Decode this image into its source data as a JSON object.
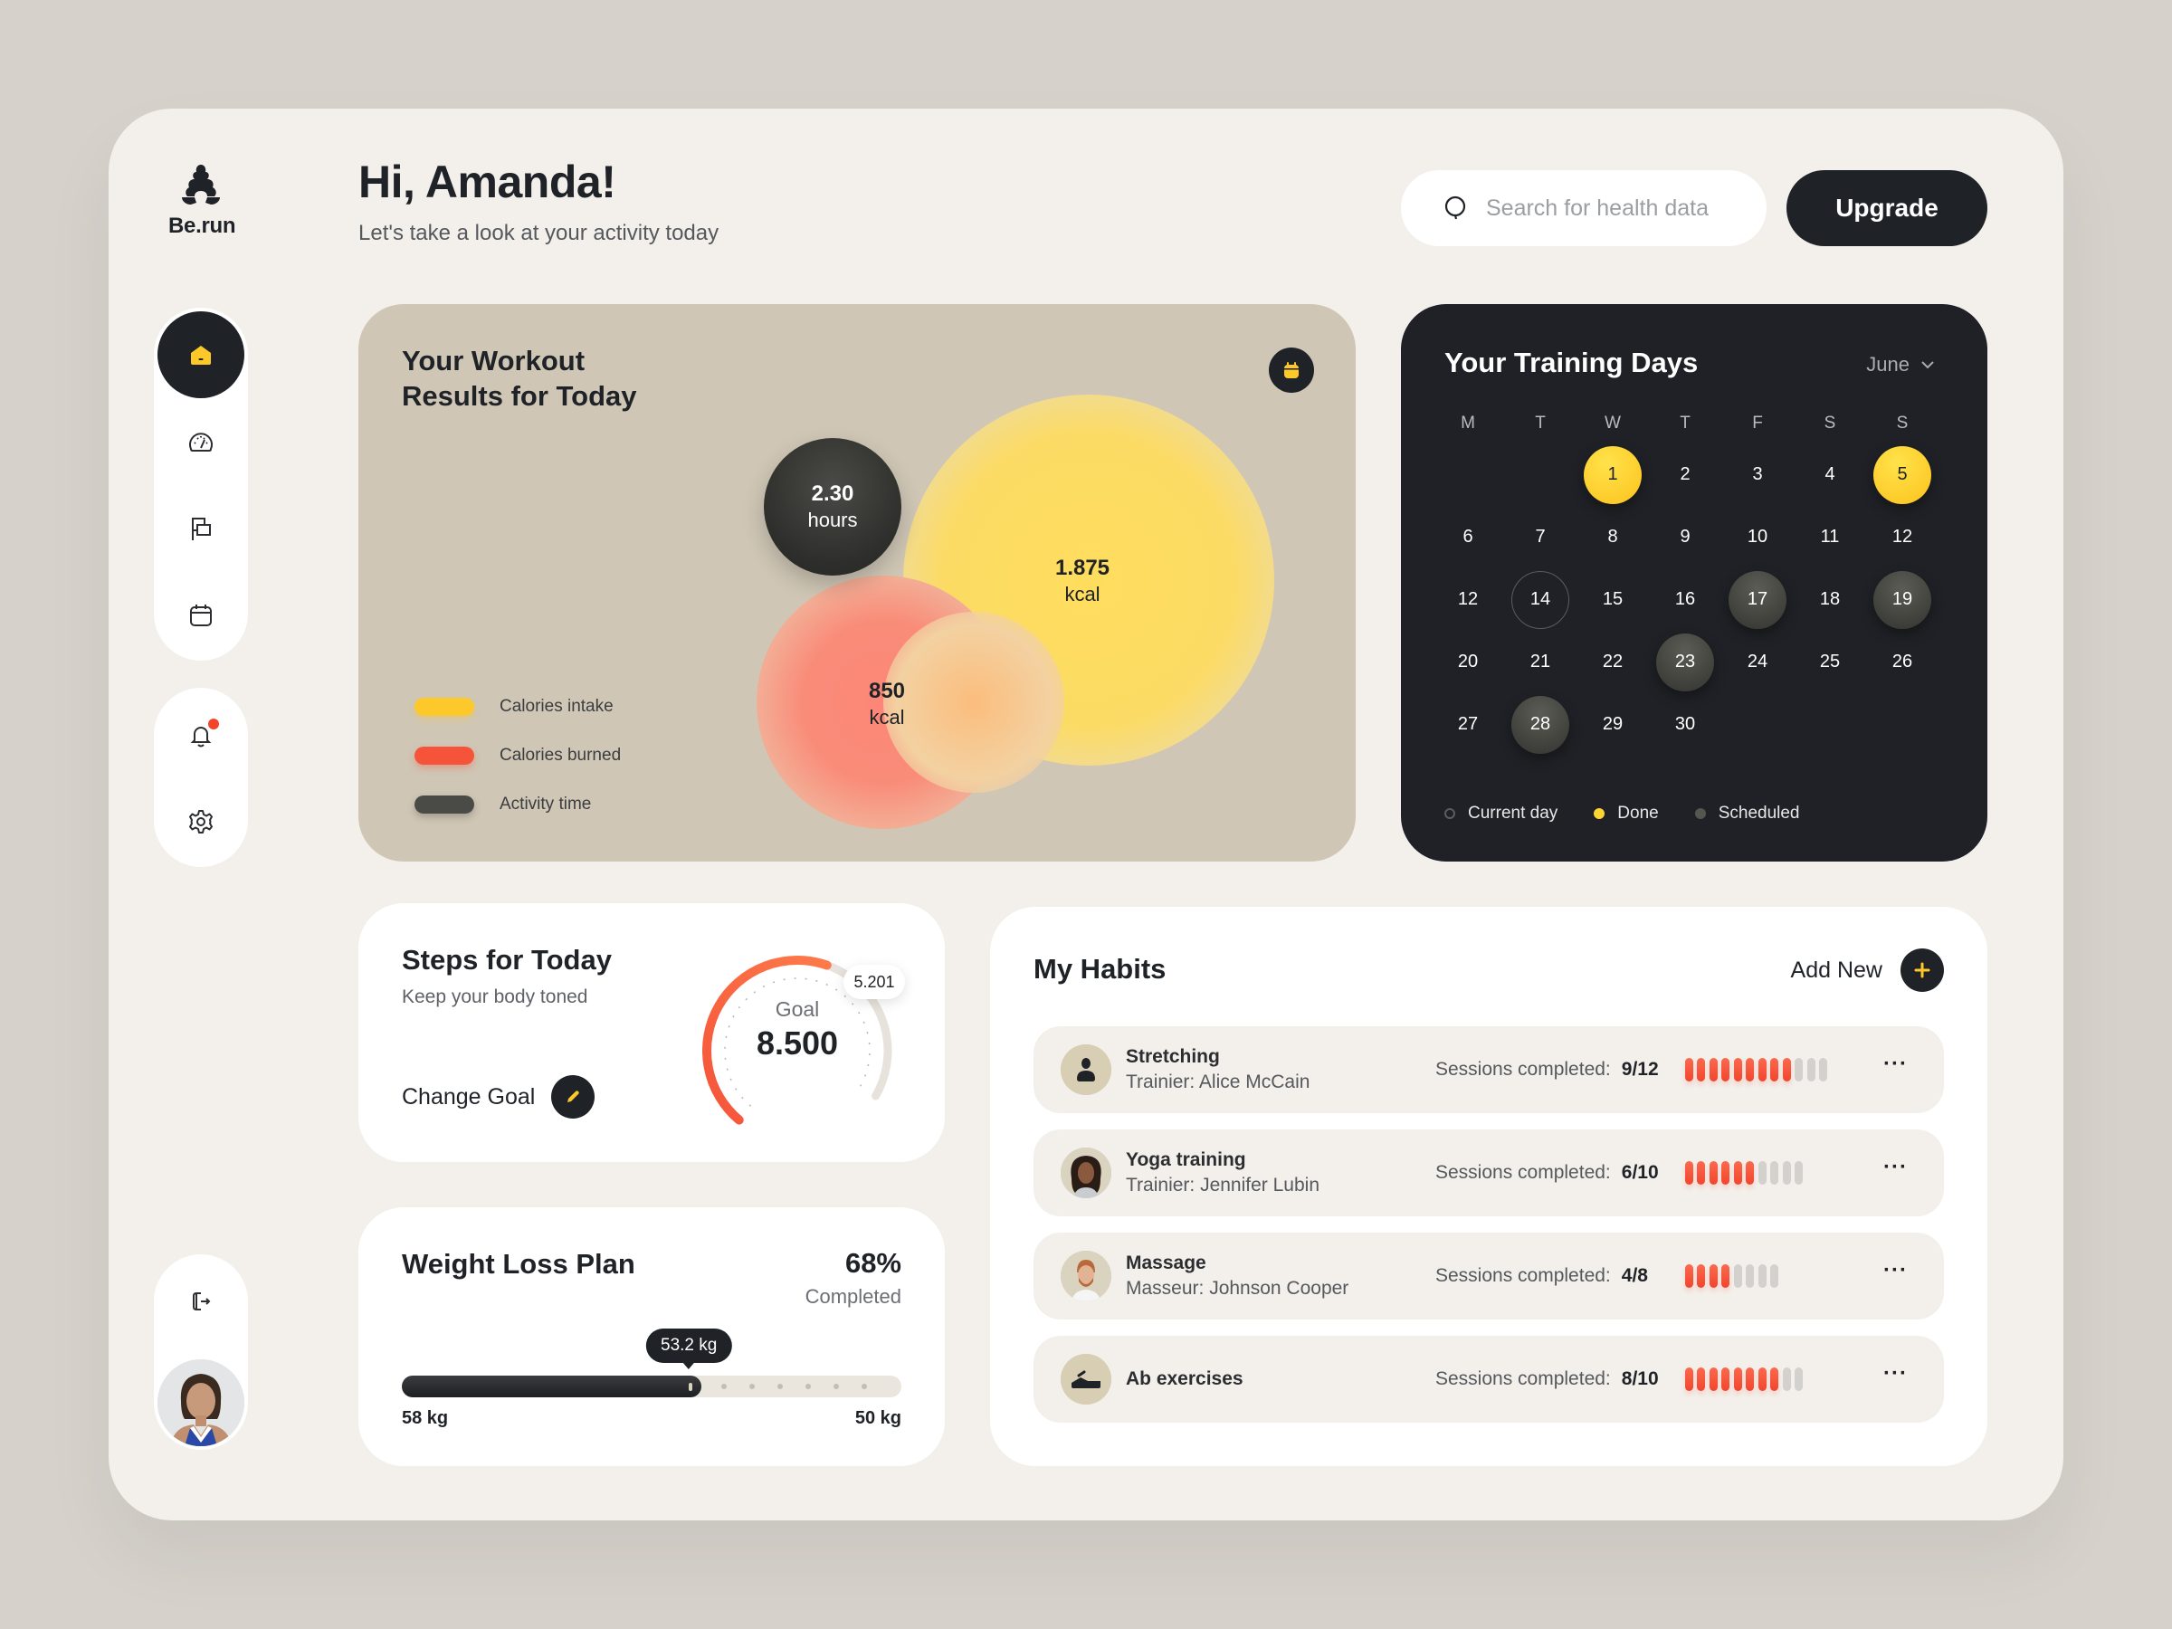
{
  "app": {
    "logo_text": "Be.run"
  },
  "header": {
    "greeting": "Hi, Amanda!",
    "subtitle": "Let's take a look at your activity today",
    "search_placeholder": "Search for health data",
    "search_value": "",
    "upgrade_label": "Upgrade"
  },
  "sidebar": {
    "items": [
      {
        "icon": "home-icon",
        "active": true
      },
      {
        "icon": "speedometer-icon",
        "active": false
      },
      {
        "icon": "flag-icon",
        "active": false
      },
      {
        "icon": "calendar-icon",
        "active": false
      },
      {
        "icon": "bell-icon",
        "active": false,
        "has_badge": true
      },
      {
        "icon": "gear-icon",
        "active": false
      },
      {
        "icon": "logout-icon",
        "active": false
      }
    ],
    "profile": "user-avatar"
  },
  "workout": {
    "title": "Your Workout Results for Today",
    "calendar_button": "calendar-icon",
    "activity": {
      "value": "2.30",
      "unit": "hours"
    },
    "intake": {
      "value": "1.875",
      "unit": "kcal"
    },
    "burned": {
      "value": "850",
      "unit": "kcal"
    },
    "legend": [
      {
        "label": "Calories intake",
        "color": "#fcc82a"
      },
      {
        "label": "Calories burned",
        "color": "#f5543a"
      },
      {
        "label": "Activity time",
        "color": "#4a4b47"
      }
    ]
  },
  "training": {
    "title": "Your Training Days",
    "month": "June",
    "weekdays": [
      "M",
      "T",
      "W",
      "T",
      "F",
      "S",
      "S"
    ],
    "weeks": [
      [
        null,
        null,
        {
          "d": "1",
          "s": "done"
        },
        {
          "d": "2"
        },
        {
          "d": "3"
        },
        {
          "d": "4"
        },
        {
          "d": "5",
          "s": "done"
        }
      ],
      [
        {
          "d": "6"
        },
        {
          "d": "7"
        },
        {
          "d": "8"
        },
        {
          "d": "9"
        },
        {
          "d": "10"
        },
        {
          "d": "11"
        },
        {
          "d": "12"
        }
      ],
      [
        {
          "d": "12"
        },
        {
          "d": "14",
          "s": "current"
        },
        {
          "d": "15"
        },
        {
          "d": "16"
        },
        {
          "d": "17",
          "s": "scheduled"
        },
        {
          "d": "18"
        },
        {
          "d": "19",
          "s": "scheduled"
        }
      ],
      [
        {
          "d": "20"
        },
        {
          "d": "21"
        },
        {
          "d": "22"
        },
        {
          "d": "23",
          "s": "scheduled"
        },
        {
          "d": "24"
        },
        {
          "d": "25"
        },
        {
          "d": "26"
        }
      ],
      [
        {
          "d": "27"
        },
        {
          "d": "28",
          "s": "scheduled"
        },
        {
          "d": "29"
        },
        {
          "d": "30"
        },
        null,
        null,
        null
      ]
    ],
    "legend": [
      {
        "label": "Current day",
        "kind": "current"
      },
      {
        "label": "Done",
        "kind": "done"
      },
      {
        "label": "Scheduled",
        "kind": "scheduled"
      }
    ],
    "colors": {
      "done": "#fcd433",
      "scheduled": "#55564f",
      "current": "#5a5c60"
    }
  },
  "steps": {
    "title": "Steps for Today",
    "subtitle": "Keep your body toned",
    "change_goal_label": "Change Goal",
    "goal_label": "Goal",
    "goal_value": "8.500",
    "current_value": "5.201",
    "progress_fraction": 0.612
  },
  "weight": {
    "title": "Weight Loss Plan",
    "percent": "68%",
    "percent_label": "Completed",
    "progress_fraction": 0.6,
    "current_label": "53.2 kg",
    "start_label": "58 kg",
    "target_label": "50 kg"
  },
  "habits": {
    "title": "My Habits",
    "add_new_label": "Add New",
    "sessions_label": "Sessions completed:",
    "items": [
      {
        "name": "Stretching",
        "trainer": "Trainier: Alice McCain",
        "done": 9,
        "total": 12,
        "count_label": "9/12",
        "avatar": "person-icon"
      },
      {
        "name": "Yoga training",
        "trainer": "Trainier: Jennifer Lubin",
        "done": 6,
        "total": 10,
        "count_label": "6/10",
        "avatar": "trainer-photo"
      },
      {
        "name": "Massage",
        "trainer": "Masseur: Johnson Cooper",
        "done": 4,
        "total": 8,
        "count_label": "4/8",
        "avatar": "masseur-photo"
      },
      {
        "name": "Ab exercises",
        "trainer": "",
        "done": 8,
        "total": 10,
        "count_label": "8/10",
        "avatar": "exercise-icon"
      }
    ],
    "more_label": "···"
  }
}
